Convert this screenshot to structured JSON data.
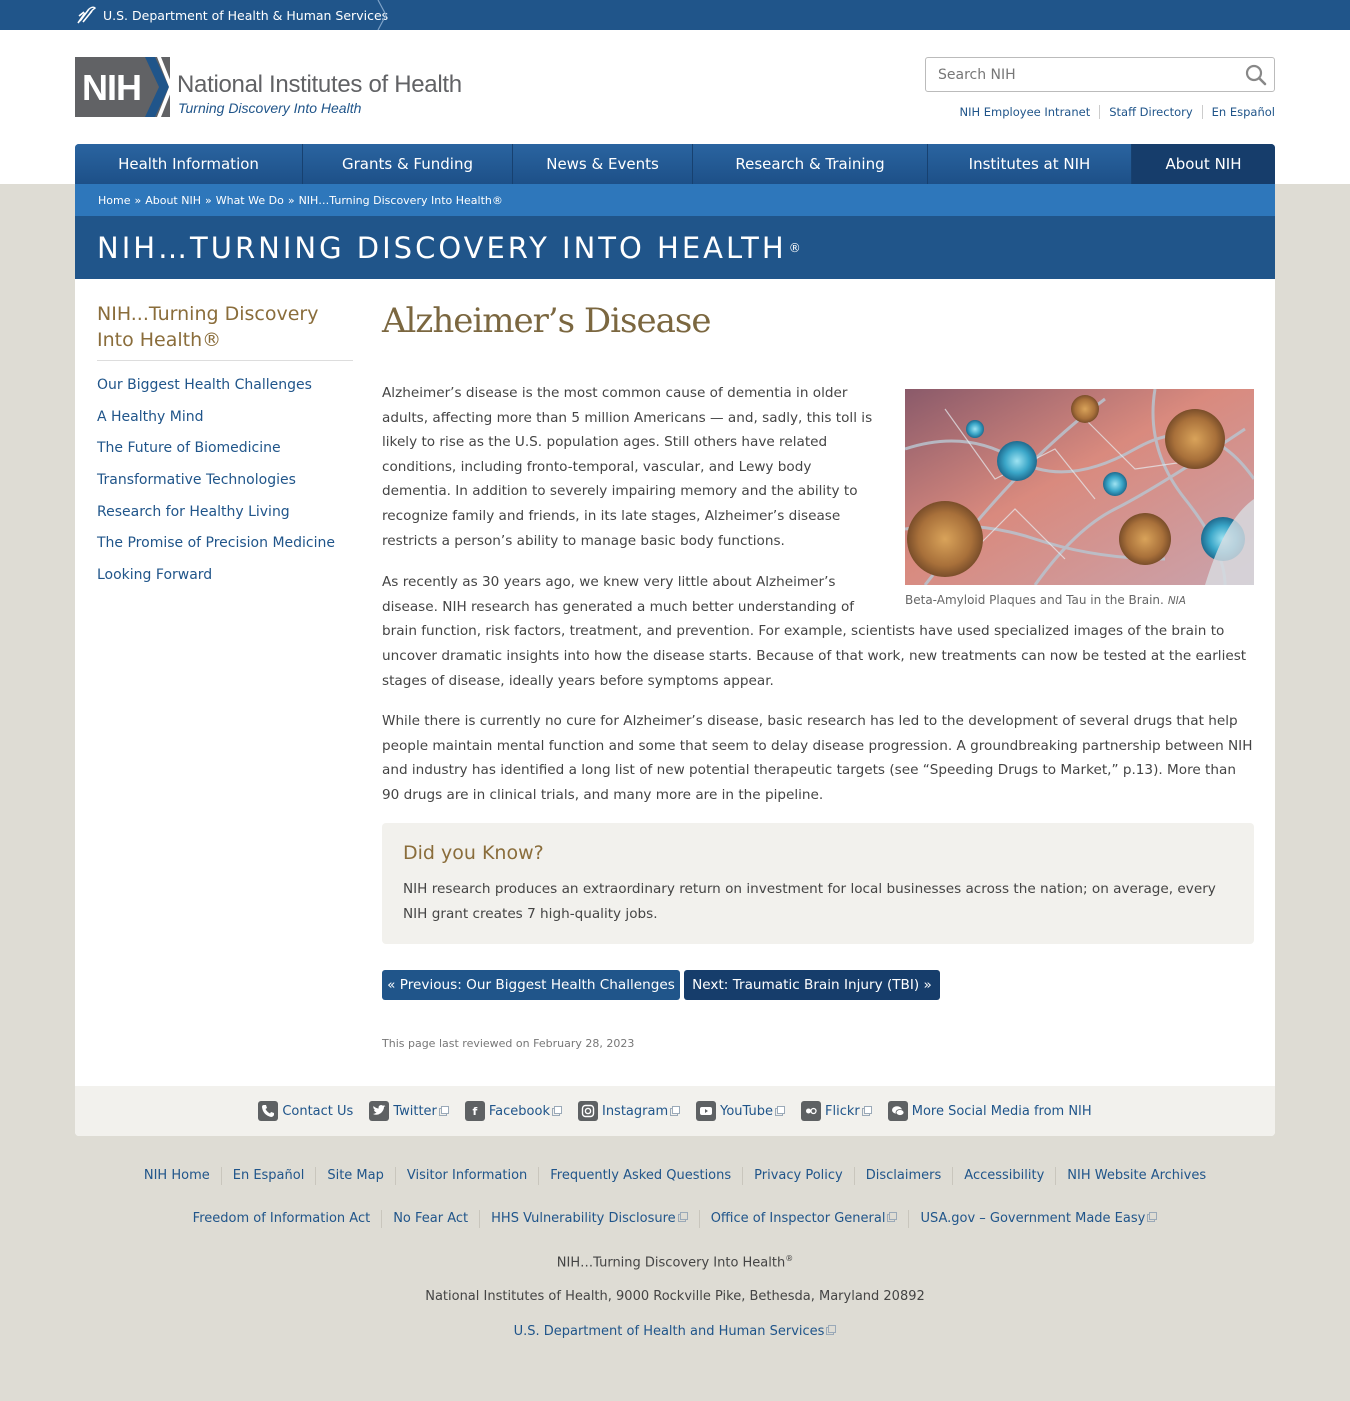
{
  "hhs": {
    "label": "U.S. Department of Health & Human Services"
  },
  "header": {
    "logo_mark": "NIH",
    "logo_name": "National Institutes of Health",
    "logo_tagline": "Turning Discovery Into Health",
    "search_placeholder": "Search NIH",
    "utility_links": [
      "NIH Employee Intranet",
      "Staff Directory",
      "En Español"
    ]
  },
  "nav": {
    "items": [
      "Health Information",
      "Grants & Funding",
      "News & Events",
      "Research & Training",
      "Institutes at NIH",
      "About NIH"
    ],
    "active": "About NIH"
  },
  "breadcrumb": [
    "Home",
    "About NIH",
    "What We Do",
    "NIH…Turning Discovery Into Health®"
  ],
  "banner": {
    "title": "NIH…TURNING DISCOVERY INTO HEALTH",
    "mark": "®"
  },
  "sidebar": {
    "title": "NIH...Turning Discovery Into Health®",
    "items": [
      "Our Biggest Health Challenges",
      "A Healthy Mind",
      "The Future of Biomedicine",
      "Transformative Technologies",
      "Research for Healthy Living",
      "The Promise of Precision Medicine",
      "Looking Forward"
    ]
  },
  "article": {
    "title": "Alzheimer’s Disease",
    "image_caption": "Beta-Amyloid Plaques and Tau in the Brain.",
    "image_credit": "NIA",
    "paragraphs": [
      "Alzheimer’s disease is the most common cause of dementia in older adults, affecting more than 5 million Americans — and, sadly, this toll is likely to rise as the U.S. population ages. Still others have related conditions, including fronto-temporal, vascular, and Lewy body dementia. In addition to severely impairing memory and the ability to recognize family and friends, in its late stages, Alzheimer’s disease restricts a person’s ability to manage basic body functions.",
      "As recently as 30 years ago, we knew very little about Alzheimer’s disease. NIH research has generated a much better understanding of brain function, risk factors, treatment, and prevention. For example, scientists have used specialized images of the brain to uncover dramatic insights into how the disease starts. Because of that work, new treatments can now be tested at the earliest stages of disease, ideally years before symptoms appear.",
      "While there is currently no cure for Alzheimer’s disease, basic research has led to the development of several drugs that help people maintain mental function and some that seem to delay disease progression. A groundbreaking partnership between NIH and industry has identified a long list of new potential therapeutic targets (see “Speeding Drugs to Market,” p.13). More than 90 drugs are in clinical trials, and many more are in the pipeline."
    ],
    "did_you_know": {
      "heading": "Did you Know?",
      "text": "NIH research produces an extraordinary return on investment for local businesses across the nation; on average, every NIH grant creates 7 high-quality jobs."
    },
    "prev_label": "« Previous: Our Biggest Health Challenges",
    "next_label": "Next: Traumatic Brain Injury (TBI) »",
    "reviewed": "This page last reviewed on February 28, 2023"
  },
  "social": [
    {
      "label": "Contact Us",
      "icon": "phone-icon",
      "external": false
    },
    {
      "label": "Twitter",
      "icon": "twitter-icon",
      "external": true
    },
    {
      "label": "Facebook",
      "icon": "facebook-icon",
      "external": true
    },
    {
      "label": "Instagram",
      "icon": "instagram-icon",
      "external": true
    },
    {
      "label": "YouTube",
      "icon": "youtube-icon",
      "external": true
    },
    {
      "label": "Flickr",
      "icon": "flickr-icon",
      "external": true
    },
    {
      "label": "More Social Media from NIH",
      "icon": "chat-icon",
      "external": false
    }
  ],
  "footer": {
    "row1": [
      "NIH Home",
      "En Español",
      "Site Map",
      "Visitor Information",
      "Frequently Asked Questions",
      "Privacy Policy",
      "Disclaimers",
      "Accessibility",
      "NIH Website Archives"
    ],
    "row2": [
      "Freedom of Information Act",
      "No Fear Act",
      "HHS Vulnerability Disclosure",
      "Office of Inspector General",
      "USA.gov – Government Made Easy"
    ],
    "row2_external": [
      false,
      false,
      true,
      true,
      true
    ],
    "tagline": "NIH…Turning Discovery Into Health",
    "tagline_mark": "®",
    "address": "National Institutes of Health, 9000 Rockville Pike, Bethesda, Maryland 20892",
    "hhs_link": "U.S. Department of Health and Human Services"
  },
  "colors": {
    "primary": "#20558a",
    "dark": "#163d6b",
    "breadcrumb": "#2e77bb",
    "gold": "#8a6d3b",
    "page_bg": "#dedcd4"
  }
}
